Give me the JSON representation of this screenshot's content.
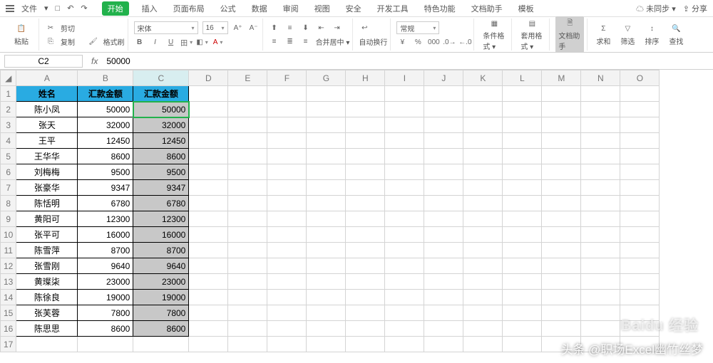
{
  "tabbar": {
    "menu1": "文件",
    "menu2": "▾",
    "tabs": [
      "开始",
      "插入",
      "页面布局",
      "公式",
      "数据",
      "审阅",
      "视图",
      "安全",
      "开发工具",
      "特色功能",
      "文档助手",
      "模板"
    ],
    "active_index": 0,
    "right1": "未同步 ▾",
    "right2": "分享"
  },
  "ribbon": {
    "cut": "剪切",
    "copy": "复制",
    "paste": "粘贴",
    "format_painter": "格式刷",
    "font_name": "宋体",
    "font_size": "16",
    "merge": "合并居中 ▾",
    "wrap": "自动换行",
    "general": "常规",
    "cond": "条件格式 ▾",
    "tblfmt": "套用格式 ▾",
    "sum_lbl": "求和",
    "filter_lbl": "筛选",
    "sort_lbl": "排序",
    "find_lbl": "查找",
    "active_btn": "文档助手"
  },
  "formula": {
    "cell_ref": "C2",
    "value": "50000"
  },
  "grid": {
    "col_headers": [
      "A",
      "B",
      "C",
      "D",
      "E",
      "F",
      "G",
      "H",
      "I",
      "J",
      "K",
      "L",
      "M",
      "N",
      "O"
    ],
    "selected_col": "C",
    "headers": [
      "姓名",
      "汇款金额",
      "汇款金额"
    ],
    "rows": [
      {
        "n": "2",
        "a": "陈小凤",
        "b": "50000",
        "c": "50000"
      },
      {
        "n": "3",
        "a": "张天",
        "b": "32000",
        "c": "32000"
      },
      {
        "n": "4",
        "a": "王平",
        "b": "12450",
        "c": "12450"
      },
      {
        "n": "5",
        "a": "王华华",
        "b": "8600",
        "c": "8600"
      },
      {
        "n": "6",
        "a": "刘梅梅",
        "b": "9500",
        "c": "9500"
      },
      {
        "n": "7",
        "a": "张豪华",
        "b": "9347",
        "c": "9347"
      },
      {
        "n": "8",
        "a": "陈恬明",
        "b": "6780",
        "c": "6780"
      },
      {
        "n": "9",
        "a": "黄阳可",
        "b": "12300",
        "c": "12300"
      },
      {
        "n": "10",
        "a": "张平可",
        "b": "16000",
        "c": "16000"
      },
      {
        "n": "11",
        "a": "陈雪萍",
        "b": "8700",
        "c": "8700"
      },
      {
        "n": "12",
        "a": "张雪刚",
        "b": "9640",
        "c": "9640"
      },
      {
        "n": "13",
        "a": "黄璨柒",
        "b": "23000",
        "c": "23000"
      },
      {
        "n": "14",
        "a": "陈徐良",
        "b": "19000",
        "c": "19000"
      },
      {
        "n": "15",
        "a": "张芙蓉",
        "b": "7800",
        "c": "7800"
      },
      {
        "n": "16",
        "a": "陈思思",
        "b": "8600",
        "c": "8600"
      }
    ]
  },
  "watermark": {
    "line1": "头条 @职场Excel幽竹丝梦",
    "line2": "Baidu 经验"
  }
}
